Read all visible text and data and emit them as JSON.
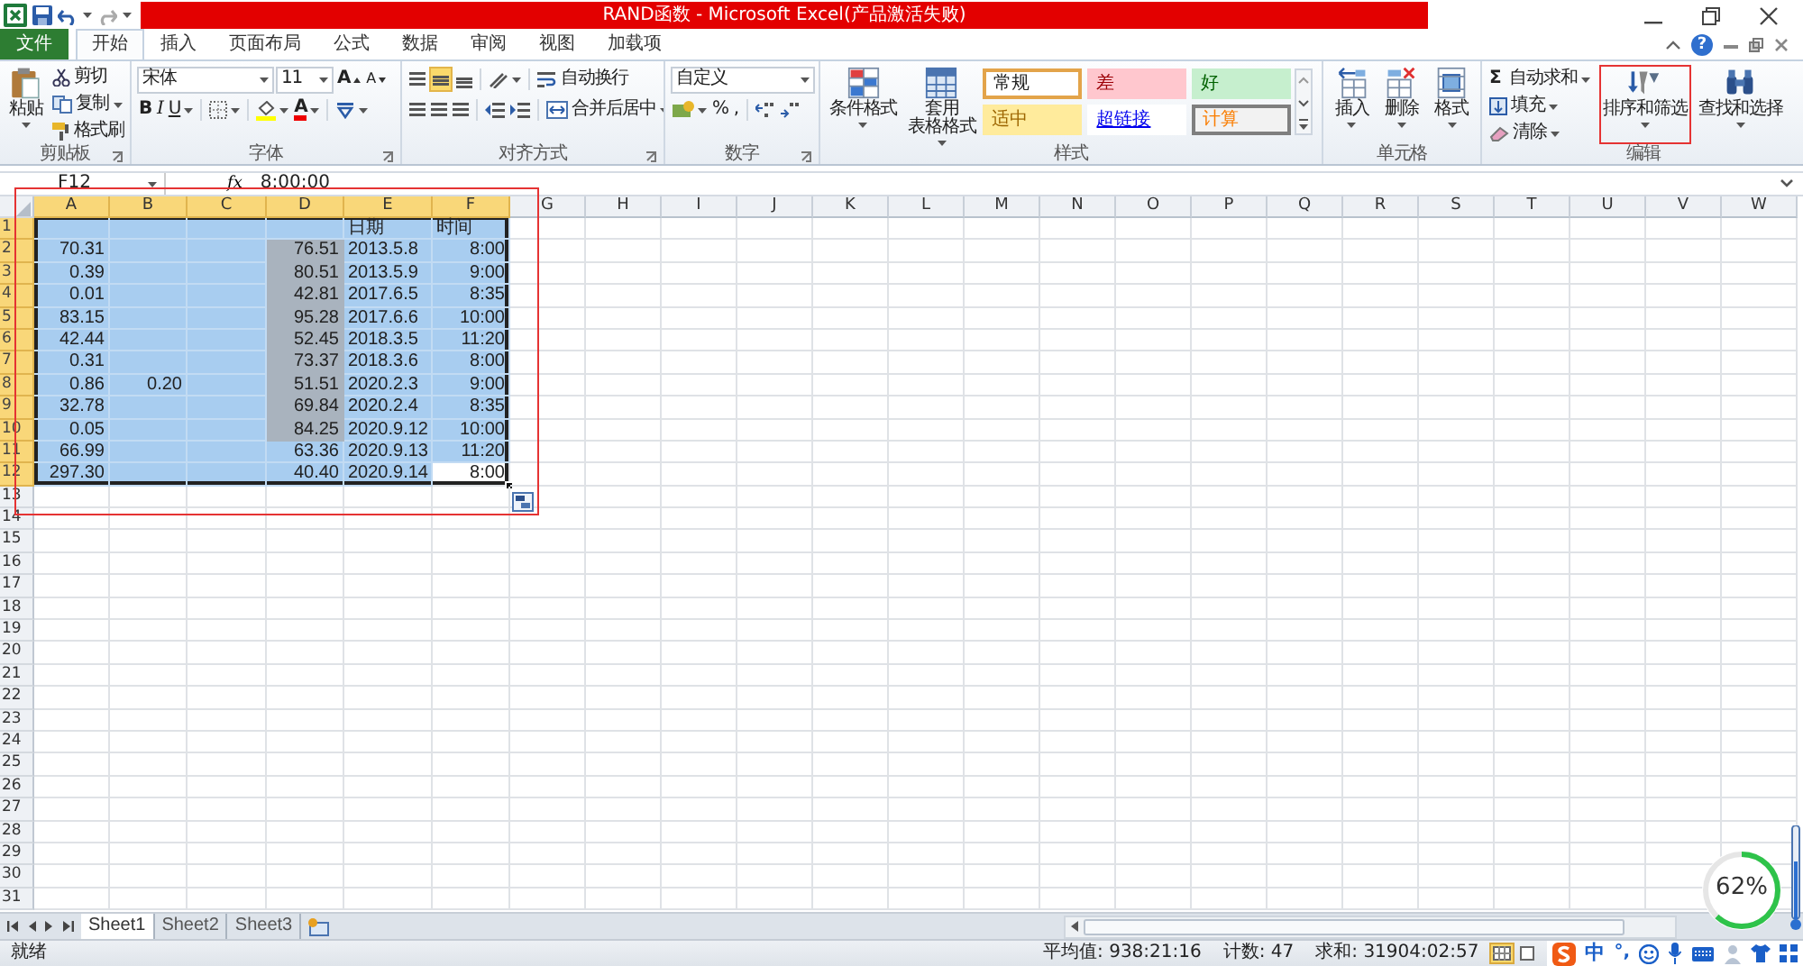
{
  "title_bar": {
    "title": "RAND函数 - Microsoft Excel(产品激活失败)"
  },
  "ribbon_tabs": [
    {
      "label": "文件",
      "kind": "file",
      "selected": false
    },
    {
      "label": "开始",
      "kind": "tab",
      "selected": true
    },
    {
      "label": "插入",
      "kind": "tab",
      "selected": false
    },
    {
      "label": "页面布局",
      "kind": "tab",
      "selected": false
    },
    {
      "label": "公式",
      "kind": "tab",
      "selected": false
    },
    {
      "label": "数据",
      "kind": "tab",
      "selected": false
    },
    {
      "label": "审阅",
      "kind": "tab",
      "selected": false
    },
    {
      "label": "视图",
      "kind": "tab",
      "selected": false
    },
    {
      "label": "加载项",
      "kind": "tab",
      "selected": false
    }
  ],
  "help_symbol": "?",
  "ribbon": {
    "clipboard": {
      "label": "剪贴板",
      "paste": "粘贴",
      "cut": "剪切",
      "copy": "复制",
      "format_painter": "格式刷"
    },
    "font": {
      "label": "字体",
      "font_name": "宋体",
      "font_size": "11",
      "grow": "A",
      "shrink": "A",
      "bold": "B",
      "italic": "I",
      "underline": "U",
      "font_color": "A"
    },
    "alignment": {
      "label": "对齐方式",
      "vertical_align": [
        {
          "selected": false
        },
        {
          "selected": true
        },
        {
          "selected": false
        }
      ],
      "wrap_text": "自动换行",
      "merge_center": "合并后居中"
    },
    "number": {
      "label": "数字",
      "format": "自定义",
      "percent": "%",
      "comma": ","
    },
    "styles": {
      "label": "样式",
      "conditional": "条件格式",
      "table_format": [
        "套用",
        "表格格式"
      ],
      "gallery": [
        {
          "label": "常规",
          "kind": "normal"
        },
        {
          "label": "差",
          "kind": "bad"
        },
        {
          "label": "好",
          "kind": "good"
        },
        {
          "label": "适中",
          "kind": "neutral"
        },
        {
          "label": "超链接",
          "kind": "hyperlink"
        },
        {
          "label": "计算",
          "kind": "calculation"
        }
      ]
    },
    "cells": {
      "label": "单元格",
      "insert": "插入",
      "delete": "删除",
      "format": "格式"
    },
    "editing": {
      "label": "编辑",
      "autosum_symbol": "Σ",
      "autosum": "自动求和",
      "fill": "填充",
      "clear": "清除",
      "sort_filter": {
        "label": "排序和筛选",
        "highlighted": true
      },
      "find_select": "查找和选择"
    }
  },
  "formula_bar": {
    "name_box": "F12",
    "fx": "fx",
    "value": "8:00:00"
  },
  "grid": {
    "annotated": true,
    "columns": [
      {
        "label": "A",
        "selected": true
      },
      {
        "label": "B",
        "selected": true
      },
      {
        "label": "C",
        "selected": true
      },
      {
        "label": "D",
        "selected": true
      },
      {
        "label": "E",
        "selected": true
      },
      {
        "label": "F",
        "selected": true
      },
      {
        "label": "G",
        "selected": false
      },
      {
        "label": "H",
        "selected": false
      },
      {
        "label": "I",
        "selected": false
      },
      {
        "label": "J",
        "selected": false
      },
      {
        "label": "K",
        "selected": false
      },
      {
        "label": "L",
        "selected": false
      },
      {
        "label": "M",
        "selected": false
      },
      {
        "label": "N",
        "selected": false
      },
      {
        "label": "O",
        "selected": false
      },
      {
        "label": "P",
        "selected": false
      },
      {
        "label": "Q",
        "selected": false
      },
      {
        "label": "R",
        "selected": false
      },
      {
        "label": "S",
        "selected": false
      },
      {
        "label": "T",
        "selected": false
      },
      {
        "label": "U",
        "selected": false
      },
      {
        "label": "V",
        "selected": false
      },
      {
        "label": "W",
        "selected": false
      }
    ],
    "rows": [
      {
        "header": "1",
        "selected": true,
        "cells": [
          {
            "shaded": false,
            "active": false
          },
          {
            "shaded": false,
            "active": false
          },
          {
            "shaded": false,
            "active": false
          },
          {
            "shaded": false,
            "active": false
          },
          {
            "text": "日期",
            "kind": "text",
            "shaded": false,
            "active": false
          },
          {
            "text": "时间",
            "kind": "text",
            "shaded": false,
            "active": false
          }
        ]
      },
      {
        "header": "2",
        "selected": true,
        "cells": [
          {
            "text": "70.31",
            "kind": "number",
            "shaded": false,
            "active": false
          },
          {
            "shaded": false,
            "active": false
          },
          {
            "shaded": false,
            "active": false
          },
          {
            "text": "76.51",
            "kind": "number",
            "shaded": true,
            "active": false
          },
          {
            "text": "2013.5.8",
            "kind": "text",
            "shaded": false,
            "active": false
          },
          {
            "text": "8:00",
            "kind": "number",
            "shaded": false,
            "active": false
          }
        ]
      },
      {
        "header": "3",
        "selected": true,
        "cells": [
          {
            "text": "0.39",
            "kind": "number",
            "shaded": false,
            "active": false
          },
          {
            "shaded": false,
            "active": false
          },
          {
            "shaded": false,
            "active": false
          },
          {
            "text": "80.51",
            "kind": "number",
            "shaded": true,
            "active": false
          },
          {
            "text": "2013.5.9",
            "kind": "text",
            "shaded": false,
            "active": false
          },
          {
            "text": "9:00",
            "kind": "number",
            "shaded": false,
            "active": false
          }
        ]
      },
      {
        "header": "4",
        "selected": true,
        "cells": [
          {
            "text": "0.01",
            "kind": "number",
            "shaded": false,
            "active": false
          },
          {
            "shaded": false,
            "active": false
          },
          {
            "shaded": false,
            "active": false
          },
          {
            "text": "42.81",
            "kind": "number",
            "shaded": true,
            "active": false
          },
          {
            "text": "2017.6.5",
            "kind": "text",
            "shaded": false,
            "active": false
          },
          {
            "text": "8:35",
            "kind": "number",
            "shaded": false,
            "active": false
          }
        ]
      },
      {
        "header": "5",
        "selected": true,
        "cells": [
          {
            "text": "83.15",
            "kind": "number",
            "shaded": false,
            "active": false
          },
          {
            "shaded": false,
            "active": false
          },
          {
            "shaded": false,
            "active": false
          },
          {
            "text": "95.28",
            "kind": "number",
            "shaded": true,
            "active": false
          },
          {
            "text": "2017.6.6",
            "kind": "text",
            "shaded": false,
            "active": false
          },
          {
            "text": "10:00",
            "kind": "number",
            "shaded": false,
            "active": false
          }
        ]
      },
      {
        "header": "6",
        "selected": true,
        "cells": [
          {
            "text": "42.44",
            "kind": "number",
            "shaded": false,
            "active": false
          },
          {
            "shaded": false,
            "active": false
          },
          {
            "shaded": false,
            "active": false
          },
          {
            "text": "52.45",
            "kind": "number",
            "shaded": true,
            "active": false
          },
          {
            "text": "2018.3.5",
            "kind": "text",
            "shaded": false,
            "active": false
          },
          {
            "text": "11:20",
            "kind": "number",
            "shaded": false,
            "active": false
          }
        ]
      },
      {
        "header": "7",
        "selected": true,
        "cells": [
          {
            "text": "0.31",
            "kind": "number",
            "shaded": false,
            "active": false
          },
          {
            "shaded": false,
            "active": false
          },
          {
            "shaded": false,
            "active": false
          },
          {
            "text": "73.37",
            "kind": "number",
            "shaded": true,
            "active": false
          },
          {
            "text": "2018.3.6",
            "kind": "text",
            "shaded": false,
            "active": false
          },
          {
            "text": "8:00",
            "kind": "number",
            "shaded": false,
            "active": false
          }
        ]
      },
      {
        "header": "8",
        "selected": true,
        "cells": [
          {
            "text": "0.86",
            "kind": "number",
            "shaded": false,
            "active": false
          },
          {
            "text": "0.20",
            "kind": "number",
            "shaded": false,
            "active": false
          },
          {
            "shaded": false,
            "active": false
          },
          {
            "text": "51.51",
            "kind": "number",
            "shaded": true,
            "active": false
          },
          {
            "text": "2020.2.3",
            "kind": "text",
            "shaded": false,
            "active": false
          },
          {
            "text": "9:00",
            "kind": "number",
            "shaded": false,
            "active": false
          }
        ]
      },
      {
        "header": "9",
        "selected": true,
        "cells": [
          {
            "text": "32.78",
            "kind": "number",
            "shaded": false,
            "active": false
          },
          {
            "shaded": false,
            "active": false
          },
          {
            "shaded": false,
            "active": false
          },
          {
            "text": "69.84",
            "kind": "number",
            "shaded": true,
            "active": false
          },
          {
            "text": "2020.2.4",
            "kind": "text",
            "shaded": false,
            "active": false
          },
          {
            "text": "8:35",
            "kind": "number",
            "shaded": false,
            "active": false
          }
        ]
      },
      {
        "header": "10",
        "selected": true,
        "cells": [
          {
            "text": "0.05",
            "kind": "number",
            "shaded": false,
            "active": false
          },
          {
            "shaded": false,
            "active": false
          },
          {
            "shaded": false,
            "active": false
          },
          {
            "text": "84.25",
            "kind": "number",
            "shaded": true,
            "active": false
          },
          {
            "text": "2020.9.12",
            "kind": "text",
            "shaded": false,
            "active": false
          },
          {
            "text": "10:00",
            "kind": "number",
            "shaded": false,
            "active": false
          }
        ]
      },
      {
        "header": "11",
        "selected": true,
        "cells": [
          {
            "text": "66.99",
            "kind": "number",
            "shaded": false,
            "active": false
          },
          {
            "shaded": false,
            "active": false
          },
          {
            "shaded": false,
            "active": false
          },
          {
            "text": "63.36",
            "kind": "number",
            "shaded": false,
            "active": false
          },
          {
            "text": "2020.9.13",
            "kind": "text",
            "shaded": false,
            "active": false
          },
          {
            "text": "11:20",
            "kind": "number",
            "shaded": false,
            "active": false
          }
        ]
      },
      {
        "header": "12",
        "selected": true,
        "cells": [
          {
            "text": "297.30",
            "kind": "number",
            "shaded": false,
            "active": false
          },
          {
            "shaded": false,
            "active": false
          },
          {
            "shaded": false,
            "active": false
          },
          {
            "text": "40.40",
            "kind": "number",
            "shaded": false,
            "active": false
          },
          {
            "text": "2020.9.14",
            "kind": "text",
            "shaded": false,
            "active": false
          },
          {
            "text": "8:00",
            "kind": "number",
            "shaded": false,
            "active": true
          }
        ]
      },
      {
        "header": "13",
        "selected": false
      },
      {
        "header": "14",
        "selected": false
      },
      {
        "header": "15",
        "selected": false
      },
      {
        "header": "16",
        "selected": false
      },
      {
        "header": "17",
        "selected": false
      },
      {
        "header": "18",
        "selected": false
      },
      {
        "header": "19",
        "selected": false
      },
      {
        "header": "20",
        "selected": false
      },
      {
        "header": "21",
        "selected": false
      },
      {
        "header": "22",
        "selected": false
      },
      {
        "header": "23",
        "selected": false
      },
      {
        "header": "24",
        "selected": false
      },
      {
        "header": "25",
        "selected": false
      },
      {
        "header": "26",
        "selected": false
      },
      {
        "header": "27",
        "selected": false
      },
      {
        "header": "28",
        "selected": false
      },
      {
        "header": "29",
        "selected": false
      },
      {
        "header": "30",
        "selected": false
      },
      {
        "header": "31",
        "selected": false
      }
    ]
  },
  "sheet_tabs": [
    {
      "label": "Sheet1",
      "selected": true
    },
    {
      "label": "Sheet2",
      "selected": false
    },
    {
      "label": "Sheet3",
      "selected": false
    }
  ],
  "status_bar": {
    "mode": "就绪",
    "average": "平均值: 938:21:16",
    "count": "计数: 47",
    "sum": "求和: 31904:02:57",
    "views": [
      {
        "selected": true
      },
      {
        "selected": false
      }
    ]
  },
  "ime_toolbar": {
    "language": "中",
    "punctuation": "°,"
  },
  "meter_widget": {
    "reading": "62%",
    "level": 0.62
  }
}
